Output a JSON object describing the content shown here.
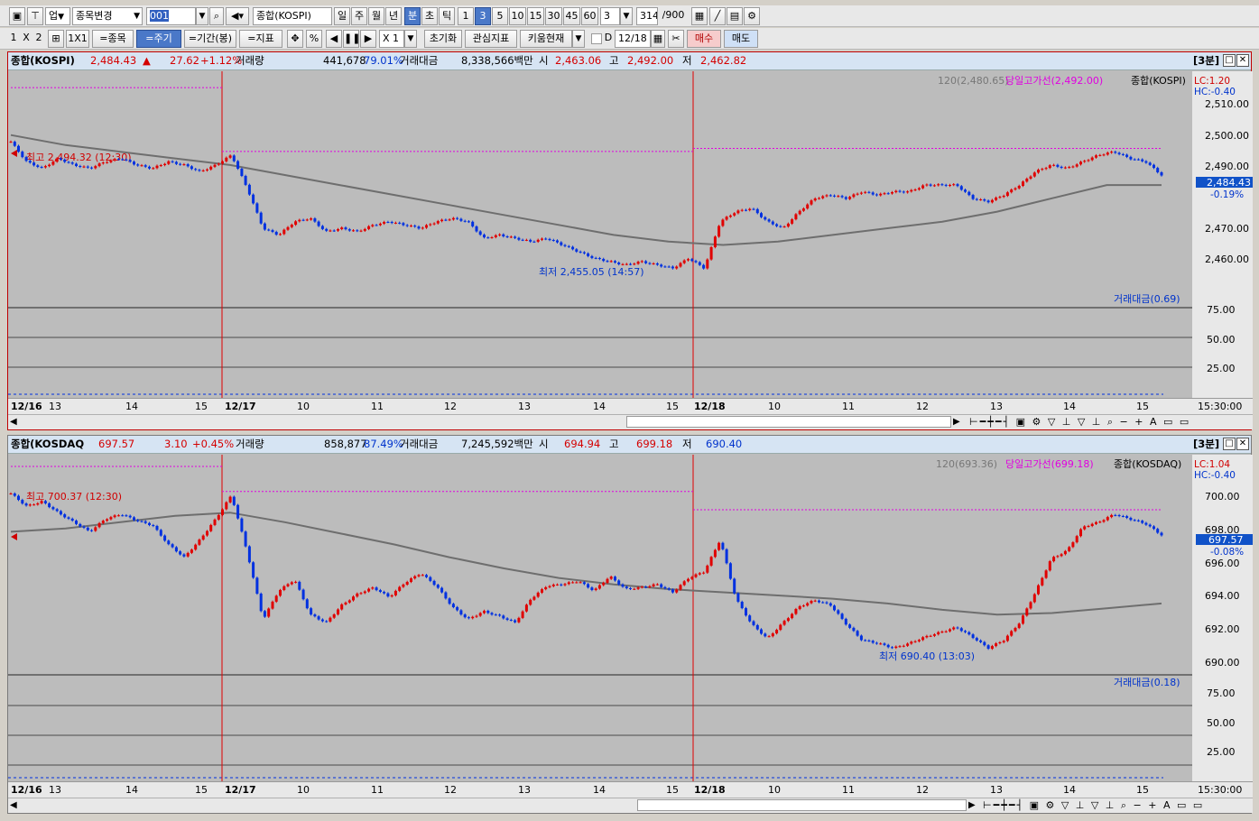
{
  "toolbar1": {
    "sector": "업",
    "change_label": "종목변경",
    "code": "001",
    "name": "종합(KOSPI)",
    "periods": [
      "일",
      "주",
      "월",
      "년",
      "분",
      "초",
      "틱"
    ],
    "minutes": [
      "1",
      "3",
      "5",
      "10",
      "15",
      "30",
      "45",
      "60"
    ],
    "minute_value": "3",
    "count": "314",
    "count_total": "/900"
  },
  "toolbar2": {
    "layout1": "1",
    "layout_x": "X",
    "layout2": "2",
    "one_by_one": "1X1",
    "stock_btn": "=종목",
    "cycle_btn": "=주기",
    "period_btn": "=기간(봉)",
    "indicator_btn": "=지표",
    "percent": "%",
    "speed": "X 1",
    "reset": "초기화",
    "watch": "관심지표",
    "kiwoom": "키움현재",
    "d_label": "D",
    "date": "12/18",
    "buy": "매수",
    "sell": "매도"
  },
  "panels": [
    {
      "name": "종합(KOSPI)",
      "price": "2,484.43",
      "arrow": "▲",
      "change": "27.62",
      "pct": "+1.12%",
      "vol_label": "거래량",
      "vol": "441,678",
      "vol_pct": "79.01%",
      "amt_label": "거래대금",
      "amt": "8,338,566백만",
      "open_label": "시",
      "open": "2,463.06",
      "high_label": "고",
      "high": "2,492.00",
      "low_label": "저",
      "low": "2,462.82",
      "interval": "[3분]",
      "legend_ma": "120(2,480.65)",
      "legend_line": "당일고가선(2,492.00)",
      "legend_name": "종합(KOSPI)",
      "lc": "LC:1.20",
      "hc": "HC:-0.40",
      "y_ticks": [
        "2,510.00",
        "2,500.00",
        "2,490.00",
        "2,470.00",
        "2,460.00"
      ],
      "current_box": "2,484.43",
      "current_pct": "-0.19%",
      "max_note": "최고 2,494.32 (12:30)",
      "min_note": "최저 2,455.05 (14:57)",
      "sub_legend": "거래대금(0.69)",
      "sub_ticks": [
        "75.00",
        "50.00",
        "25.00"
      ],
      "x_labels": [
        "12/16",
        "13",
        "14",
        "15",
        "12/17",
        "10",
        "11",
        "12",
        "13",
        "14",
        "15",
        "12/18",
        "10",
        "11",
        "12",
        "13",
        "14",
        "15"
      ],
      "time_end": "15:30:00"
    },
    {
      "name": "종합(KOSDAQ",
      "price": "697.57",
      "arrow": "▲",
      "change": "3.10",
      "pct": "+0.45%",
      "vol_label": "거래량",
      "vol": "858,877",
      "vol_pct": "87.49%",
      "amt_label": "거래대금",
      "amt": "7,245,592백만",
      "open_label": "시",
      "open": "694.94",
      "high_label": "고",
      "high": "699.18",
      "low_label": "저",
      "low": "690.40",
      "interval": "[3분]",
      "legend_ma": "120(693.36)",
      "legend_line": "당일고가선(699.18)",
      "legend_name": "종합(KOSDAQ)",
      "lc": "LC:1.04",
      "hc": "HC:-0.40",
      "y_ticks": [
        "700.00",
        "698.00",
        "696.00",
        "694.00",
        "692.00",
        "690.00"
      ],
      "current_box": "697.57",
      "current_pct": "-0.08%",
      "max_note": "최고 700.37 (12:30)",
      "min_note": "최저 690.40 (13:03)",
      "sub_legend": "거래대금(0.18)",
      "sub_ticks": [
        "75.00",
        "50.00",
        "25.00"
      ],
      "x_labels": [
        "12/16",
        "13",
        "14",
        "15",
        "12/17",
        "10",
        "11",
        "12",
        "13",
        "14",
        "15",
        "12/18",
        "10",
        "11",
        "12",
        "13",
        "14",
        "15"
      ],
      "time_end": "15:30:00"
    }
  ],
  "colors": {
    "up": "#e00000",
    "down": "#0030e0",
    "ma": "#777777",
    "highline": "#e000e0",
    "panel_bg": "#bcbcbc",
    "grid": "#707070"
  },
  "chart_data": [
    {
      "type": "candlestick",
      "title": "종합(KOSPI) 3분",
      "y_axis": [
        2455,
        2513
      ],
      "session_days": [
        "12/16",
        "12/17",
        "12/18"
      ],
      "price_path": [
        2494,
        2488,
        2486,
        2489,
        2487,
        2486,
        2488,
        2489,
        2487,
        2486,
        2488,
        2487,
        2485,
        2487,
        2490,
        2480,
        2468,
        2466,
        2470,
        2471,
        2467,
        2468,
        2467,
        2469,
        2470,
        2469,
        2468,
        2470,
        2471,
        2470,
        2465,
        2466,
        2465,
        2464,
        2465,
        2463,
        2461,
        2459,
        2458,
        2457,
        2458,
        2457,
        2456,
        2459,
        2456,
        2470,
        2473,
        2474,
        2470,
        2468,
        2473,
        2477,
        2478,
        2477,
        2479,
        2478,
        2479,
        2479,
        2481,
        2481,
        2481,
        2477,
        2476,
        2478,
        2481,
        2485,
        2487,
        2486,
        2488,
        2490,
        2491,
        2489,
        2488,
        2484
      ],
      "ma120_path": [
        2496,
        2493,
        2491,
        2489,
        2487,
        2484,
        2481,
        2478,
        2475,
        2472,
        2469,
        2466,
        2464,
        2463,
        2464,
        2466,
        2468,
        2470,
        2473,
        2477,
        2481,
        2481
      ],
      "high_line": 2492.0,
      "max_note_value": 2494.32,
      "min_note_value": 2455.05,
      "current": 2484.43
    },
    {
      "type": "candlestick",
      "title": "종합(KOSDAQ) 3분",
      "y_axis": [
        689.5,
        701.5
      ],
      "session_days": [
        "12/16",
        "12/17",
        "12/18"
      ],
      "price_path": [
        700.2,
        699.4,
        699.7,
        699.0,
        698.4,
        697.8,
        698.6,
        698.9,
        698.5,
        698.2,
        697.0,
        696.2,
        697.3,
        698.6,
        700.1,
        696.5,
        692.3,
        694.1,
        694.8,
        692.6,
        692.1,
        693.2,
        693.9,
        694.3,
        693.7,
        694.6,
        695.2,
        694.4,
        693.1,
        692.3,
        692.8,
        692.5,
        692.1,
        693.6,
        694.4,
        694.5,
        694.7,
        694.1,
        695.0,
        694.2,
        694.3,
        694.5,
        694.0,
        694.9,
        695.3,
        697.3,
        693.6,
        692.0,
        691.1,
        692.1,
        693.1,
        693.5,
        693.2,
        692.0,
        691.0,
        690.8,
        690.5,
        690.8,
        691.2,
        691.5,
        691.8,
        691.2,
        690.5,
        691.0,
        692.1,
        694.0,
        696.1,
        696.6,
        698.1,
        698.4,
        698.9,
        698.6,
        698.3,
        697.6
      ],
      "ma120_path": [
        697.8,
        698.0,
        698.4,
        698.8,
        699.0,
        698.4,
        697.7,
        697.0,
        696.2,
        695.5,
        694.9,
        694.5,
        694.2,
        694.0,
        693.8,
        693.6,
        693.3,
        692.9,
        692.6,
        692.7,
        693.0,
        693.3
      ],
      "high_line": 699.18,
      "max_note_value": 700.37,
      "min_note_value": 690.4,
      "current": 697.57
    }
  ]
}
